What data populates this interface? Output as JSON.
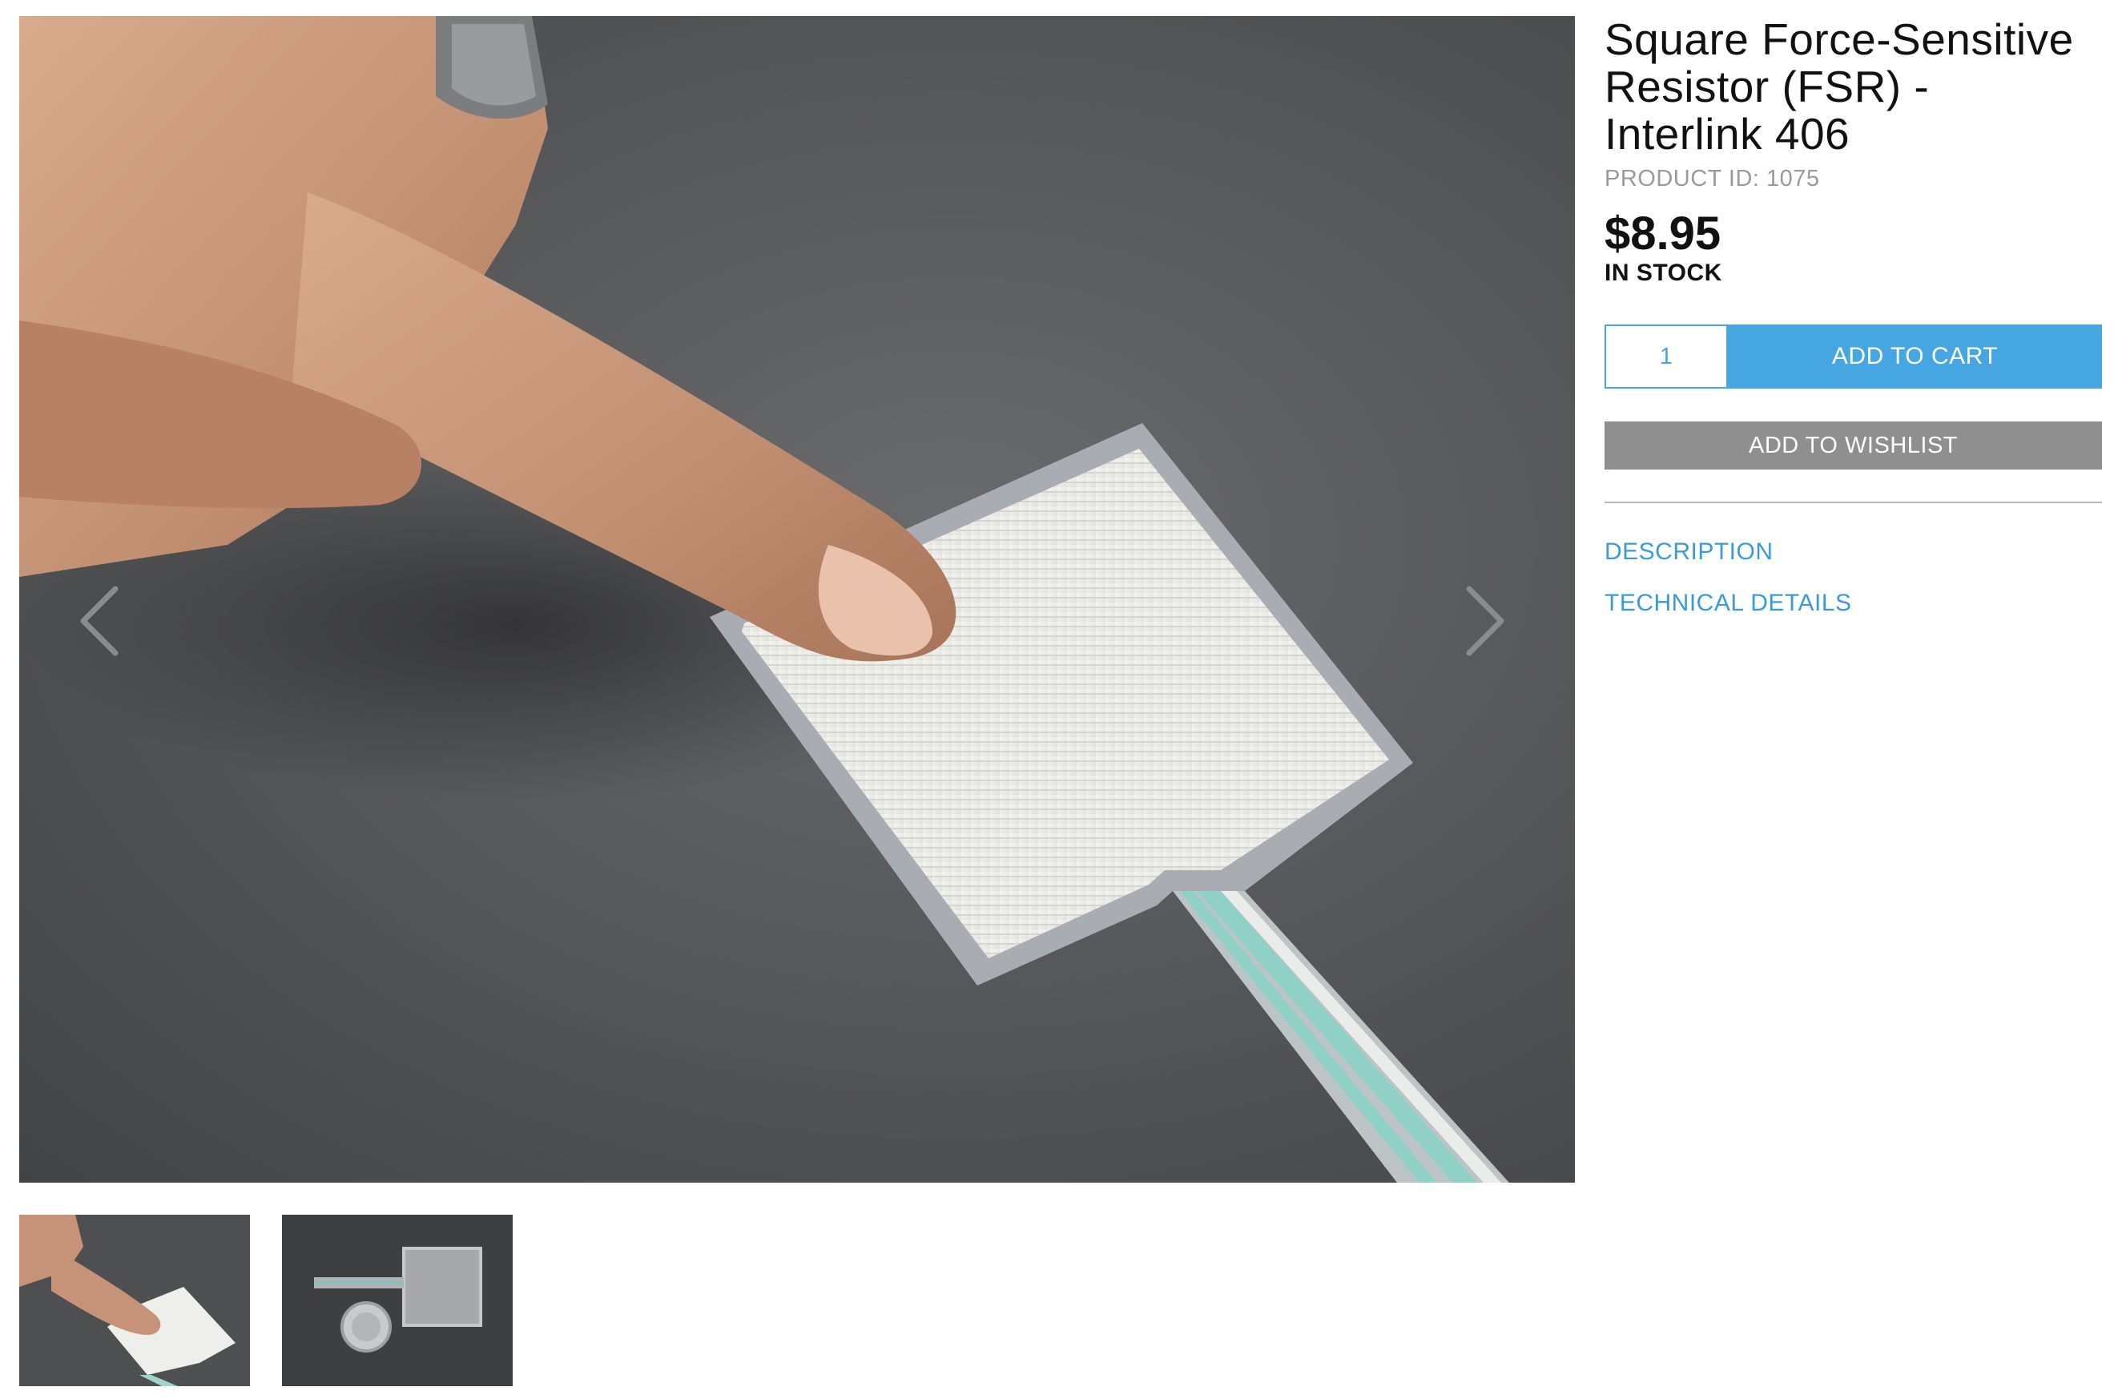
{
  "product": {
    "title": "Square Force-Sensitive Resistor (FSR) - Interlink 406",
    "product_id_label": "PRODUCT ID: 1075",
    "price": "$8.95",
    "stock_status": "IN STOCK"
  },
  "cart": {
    "quantity": "1",
    "add_to_cart_label": "ADD TO CART",
    "add_to_wishlist_label": "ADD TO WISHLIST"
  },
  "tabs": {
    "description_label": "DESCRIPTION",
    "technical_details_label": "TECHNICAL DETAILS"
  },
  "gallery": {
    "prev_icon": "chevron-left-icon",
    "next_icon": "chevron-right-icon",
    "thumbnail_count": 2
  },
  "colors": {
    "accent": "#46a6e2",
    "link": "#3a9bdc",
    "wishlist_bg": "#8f8f8f",
    "muted_text": "#9a9a9a"
  }
}
